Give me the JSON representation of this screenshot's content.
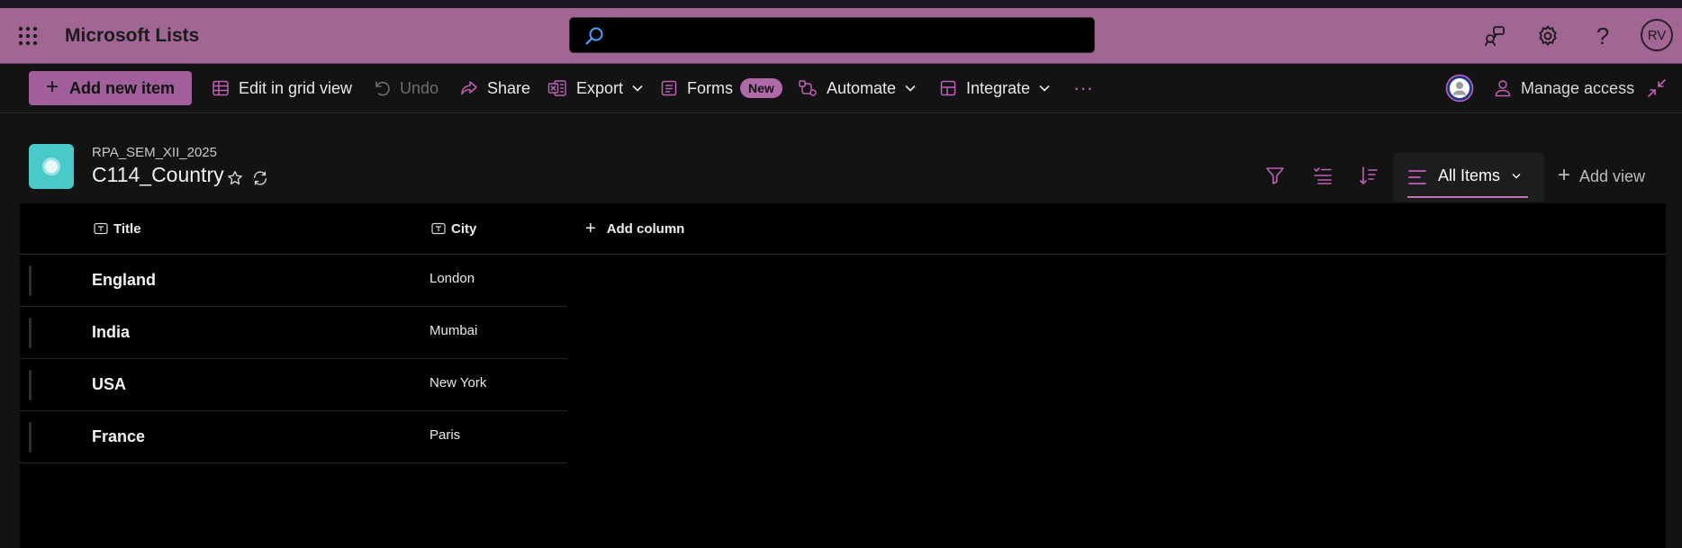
{
  "suite": {
    "app_name": "Microsoft Lists",
    "search_placeholder": "",
    "avatar_initials": "RV"
  },
  "commands": {
    "add_new_item": "Add new item",
    "edit_grid": "Edit in grid view",
    "undo": "Undo",
    "share": "Share",
    "export": "Export",
    "forms": "Forms",
    "forms_badge": "New",
    "automate": "Automate",
    "integrate": "Integrate",
    "more": "···",
    "manage_access": "Manage access"
  },
  "list": {
    "site_name": "RPA_SEM_XII_2025",
    "title": "C114_Country",
    "view_name": "All Items",
    "add_view": "Add view"
  },
  "columns": {
    "title": "Title",
    "city": "City",
    "add_column": "Add column"
  },
  "rows": [
    {
      "title": "England",
      "city": "London"
    },
    {
      "title": "India",
      "city": "Mumbai"
    },
    {
      "title": "USA",
      "city": "New York"
    },
    {
      "title": "France",
      "city": "Paris"
    }
  ],
  "colors": {
    "suite_bar": "#a26695",
    "accent": "#a15f9b",
    "list_icon": "#49c9c9",
    "grid_bg": "#000000"
  },
  "icons": {
    "waffle": "app-launcher-icon",
    "search": "search-icon",
    "feedback": "feedback-icon",
    "settings": "gear-icon",
    "help": "help-icon",
    "favorite": "star-icon",
    "sync": "sync-icon",
    "filter": "filter-icon",
    "group": "group-by-icon",
    "sort": "sort-icon",
    "collapse": "collapse-icon"
  }
}
